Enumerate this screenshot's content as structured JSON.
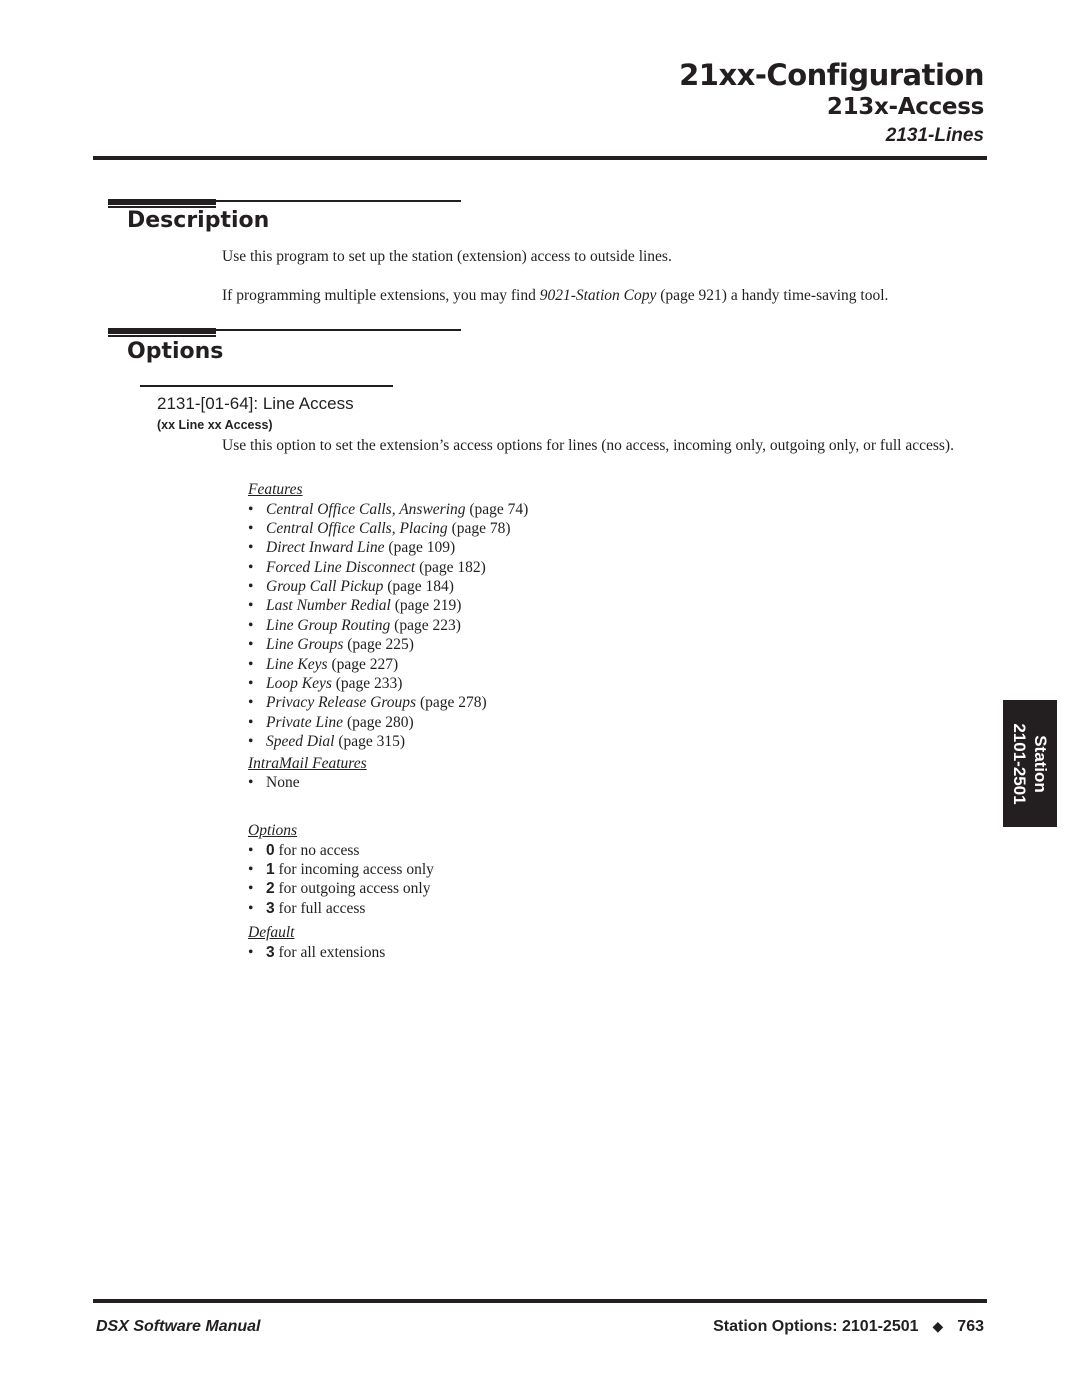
{
  "header": {
    "title": "21xx-Configuration",
    "subtitle": "213x-Access",
    "subsubtitle": "2131-Lines"
  },
  "description": {
    "heading": "Description",
    "paragraph1": "Use this program to set up the station (extension) access to outside lines.",
    "paragraph2_prefix": "If programming multiple extensions, you may find ",
    "paragraph2_link": "9021-Station Copy",
    "paragraph2_suffix": " (page 921) a handy time-saving tool."
  },
  "options_section": {
    "heading": "Options",
    "option_title": "2131-[01-64]: Line Access",
    "option_subtitle": "(xx Line xx Access)",
    "option_description": "Use this option to set the extension’s access options for lines (no access, incoming only, outgoing only, or full access).",
    "features": {
      "heading": "Features",
      "items": [
        {
          "name": "Central Office Calls, Answering",
          "page": " (page 74)"
        },
        {
          "name": "Central Office Calls, Placing",
          "page": " (page 78)"
        },
        {
          "name": "Direct Inward Line",
          "page": " (page 109)"
        },
        {
          "name": "Forced Line Disconnect",
          "page": " (page 182)"
        },
        {
          "name": "Group Call Pickup",
          "page": " (page 184)"
        },
        {
          "name": "Last Number Redial",
          "page": " (page 219)"
        },
        {
          "name": "Line Group Routing",
          "page": " (page 223)"
        },
        {
          "name": "Line Groups",
          "page": " (page 225)"
        },
        {
          "name": "Line Keys",
          "page": " (page 227)"
        },
        {
          "name": "Loop Keys",
          "page": " (page 233)"
        },
        {
          "name": "Privacy Release Groups",
          "page": " (page 278)"
        },
        {
          "name": "Private Line",
          "page": " (page 280)"
        },
        {
          "name": "Speed Dial",
          "page": " (page 315)"
        }
      ]
    },
    "intramail": {
      "heading": "IntraMail Features",
      "items": [
        "None"
      ]
    },
    "options": {
      "heading": "Options",
      "items": [
        {
          "value": "0",
          "text": " for no access"
        },
        {
          "value": "1",
          "text": " for incoming access only"
        },
        {
          "value": "2",
          "text": " for outgoing access only"
        },
        {
          "value": "3",
          "text": " for full access"
        }
      ]
    },
    "default": {
      "heading": "Default",
      "items": [
        {
          "value": "3",
          "text": " for all extensions"
        }
      ]
    }
  },
  "side_tab": {
    "line1": "Station",
    "line2": "2101-2501"
  },
  "footer": {
    "left": "DSX Software Manual",
    "right_label": "Station Options: 2101-2501",
    "separator": "◆",
    "page_number": "763"
  },
  "bullet": "•"
}
